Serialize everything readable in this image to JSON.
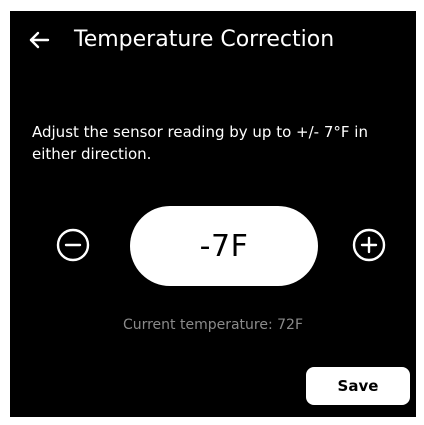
{
  "header": {
    "title": "Temperature Correction",
    "back_icon": "arrow-left-icon"
  },
  "description": "Adjust the sensor reading by up to +/- 7°F in either direction.",
  "stepper": {
    "value": "-7F",
    "decrement_icon": "minus-circle-icon",
    "increment_icon": "plus-circle-icon"
  },
  "current_temperature": "Current temperature:  72F",
  "save_label": "Save",
  "colors": {
    "background": "#000000",
    "foreground": "#ffffff",
    "muted_text": "#8a8a8a"
  }
}
